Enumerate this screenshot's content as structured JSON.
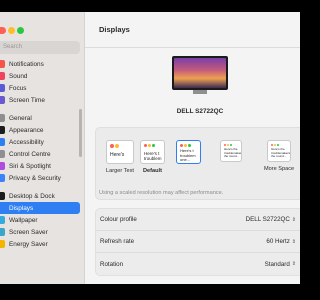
{
  "sidebar": {
    "search_placeholder": "Search",
    "items": [
      {
        "label": "Notifications",
        "color": "#f4554a"
      },
      {
        "label": "Sound",
        "color": "#f0445e"
      },
      {
        "label": "Focus",
        "color": "#5b5bd6"
      },
      {
        "label": "Screen Time",
        "color": "#6a5acd"
      },
      {
        "label": "General",
        "color": "#8e8e93"
      },
      {
        "label": "Appearance",
        "color": "#1c1c1e"
      },
      {
        "label": "Accessibility",
        "color": "#2f7ef2"
      },
      {
        "label": "Control Centre",
        "color": "#8e8e93"
      },
      {
        "label": "Siri & Spotlight",
        "color": "#b04ce0"
      },
      {
        "label": "Privacy & Security",
        "color": "#3b82f6"
      },
      {
        "label": "Desktop & Dock",
        "color": "#1c1c1e"
      },
      {
        "label": "Displays",
        "color": "#2f7ef2"
      },
      {
        "label": "Wallpaper",
        "color": "#35aadc"
      },
      {
        "label": "Screen Saver",
        "color": "#3aa6c9"
      },
      {
        "label": "Energy Saver",
        "color": "#f5b400"
      }
    ]
  },
  "main": {
    "title": "Displays",
    "monitor_name": "DELL S2722QC",
    "resolution_options": [
      {
        "label": "Larger Text",
        "preview": "Here's"
      },
      {
        "label": "Default",
        "preview": "Here's t\ntroublem"
      },
      {
        "label": "",
        "preview": "Here's t\ntroublem\none..."
      },
      {
        "label": "",
        "preview": "Here's the\ntroublemakers,\nthe round..."
      },
      {
        "label": "More Space",
        "preview": "Here's the\ntroublemakers,\nthe round..."
      }
    ],
    "perf_note": "Using a scaled resolution may affect performance.",
    "settings": [
      {
        "label": "Colour profile",
        "value": "DELL S2722QC"
      },
      {
        "label": "Refresh rate",
        "value": "60 Hertz"
      },
      {
        "label": "Rotation",
        "value": "Standard"
      }
    ]
  },
  "colors": {
    "accent": "#2f7ef2"
  }
}
